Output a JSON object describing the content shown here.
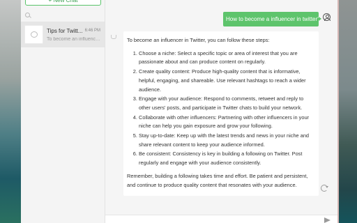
{
  "sidebar": {
    "new_chat_label": "+ New Chat",
    "search_placeholder": "",
    "chats": [
      {
        "title": "Tips for Twitt...",
        "time": "6:46 PM",
        "preview": "To become an influence..."
      }
    ]
  },
  "conversation": {
    "user_message": "How to become a influencer in twitter?",
    "assistant_message": {
      "intro": "To become an influencer in Twitter, you can follow these steps:",
      "steps": [
        "Choose a niche: Select a specific topic or area of interest that you are passionate about and can produce content on regularly.",
        "Create quality content: Produce high-quality content that is informative, helpful, engaging, and shareable. Use relevant hashtags to reach a wider audience.",
        "Engage with your audience: Respond to comments, retweet and reply to other users' posts, and participate in Twitter chats to build your network.",
        "Collaborate with other influencers: Partnering with other influencers in your niche can help you gain exposure and grow your following.",
        "Stay up-to-date: Keep up with the latest trends and news in your niche and share relevant content to keep your audience informed.",
        "Be consistent: Consistency is key in building a following on Twitter. Post regularly and engage with your audience consistently."
      ],
      "outro": "Remember, building a following takes time and effort. Be patient and persistent, and continue to produce quality content that resonates with your audience."
    }
  },
  "composer": {
    "placeholder": ""
  },
  "icons": {
    "search": "search-icon",
    "chat_avatar": "chat-bubble-icon",
    "user_avatar": "user-icon",
    "bot_avatar": "bot-icon",
    "refresh": "refresh-icon",
    "send": "send-icon"
  },
  "colors": {
    "accent": "#5ec46c",
    "accent_text": "#3aa04f"
  }
}
